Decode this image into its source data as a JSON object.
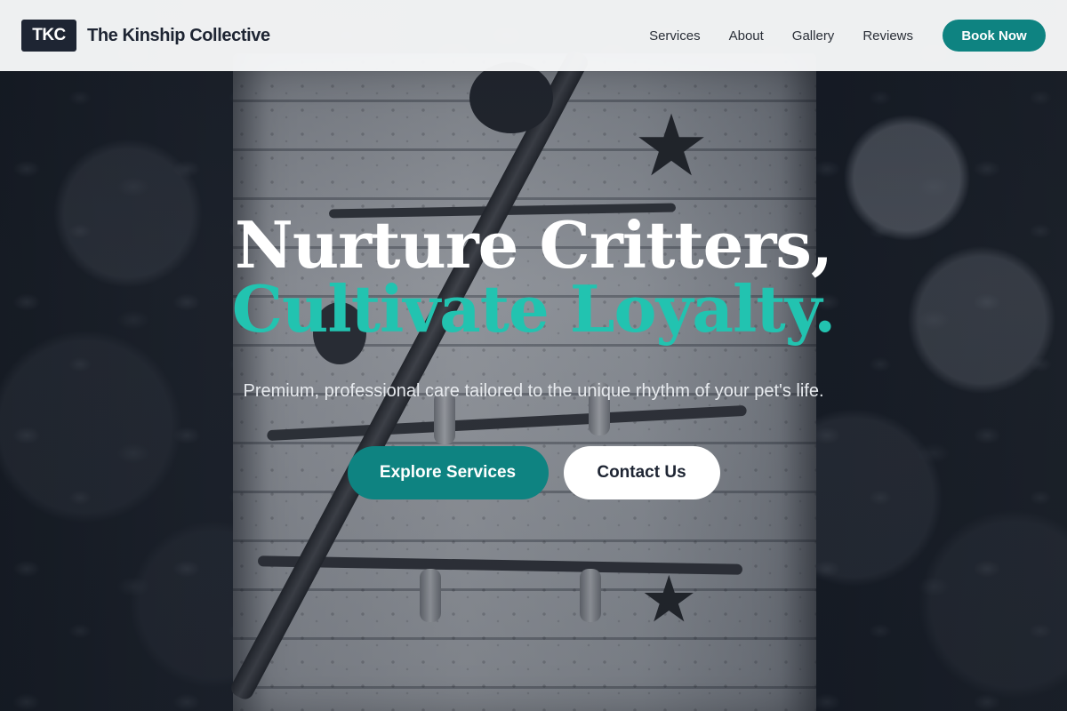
{
  "header": {
    "logo_text": "TKC",
    "brand_name": "The Kinship Collective",
    "nav": [
      {
        "label": "Services"
      },
      {
        "label": "About"
      },
      {
        "label": "Gallery"
      },
      {
        "label": "Reviews"
      }
    ],
    "cta_label": "Book Now"
  },
  "hero": {
    "headline_line1": "Nurture Critters,",
    "headline_line2": "Cultivate Loyalty.",
    "subtitle": "Premium, professional care tailored to the unique rhythm of your pet's life.",
    "primary_cta": "Explore Services",
    "secondary_cta": "Contact Us"
  },
  "colors": {
    "accent": "#0e8381",
    "headline_accent": "#22c3b0",
    "dark": "#1e2533"
  }
}
